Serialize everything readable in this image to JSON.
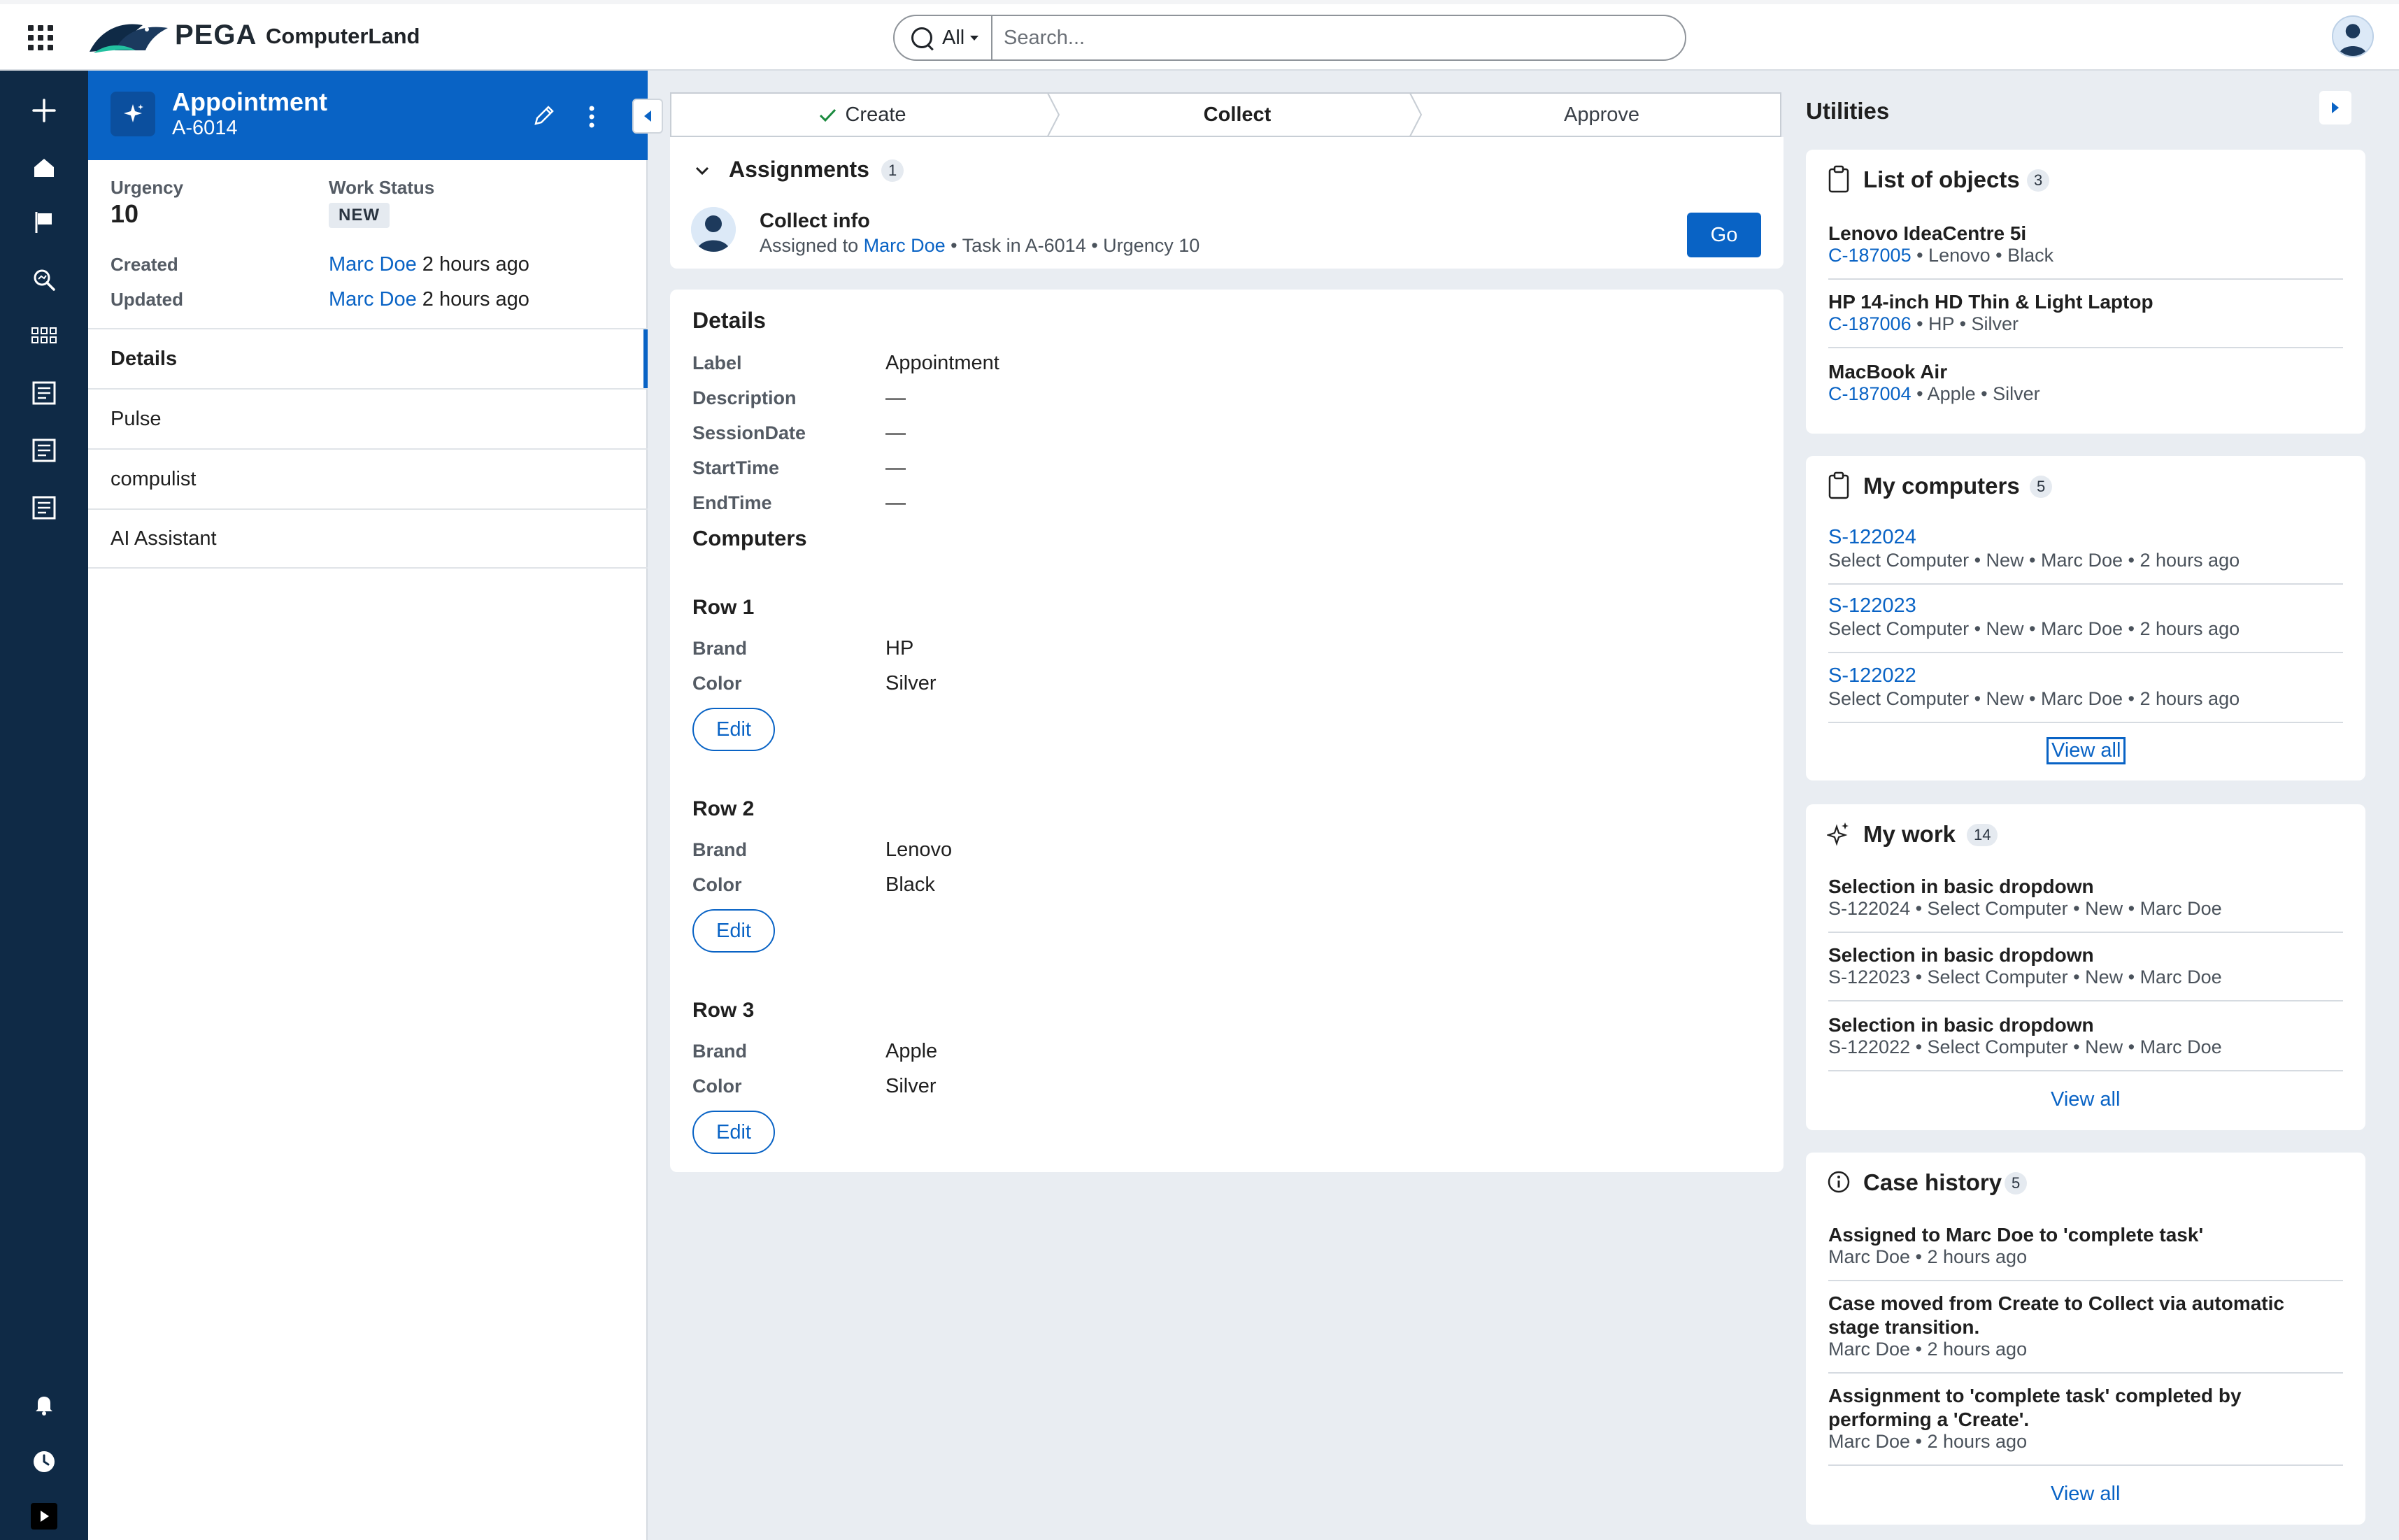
{
  "header": {
    "brand": "PEGA",
    "app_name": "ComputerLand",
    "search_scope": "All",
    "search_placeholder": "Search..."
  },
  "case": {
    "title": "Appointment",
    "id": "A-6014",
    "urgency_label": "Urgency",
    "urgency_value": "10",
    "work_status_label": "Work Status",
    "work_status_value": "NEW",
    "created_label": "Created",
    "created_by": "Marc Doe",
    "created_time": "2 hours ago",
    "updated_label": "Updated",
    "updated_by": "Marc Doe",
    "updated_time": "2 hours ago",
    "tabs": [
      {
        "label": "Details"
      },
      {
        "label": "Pulse"
      },
      {
        "label": "compulist"
      },
      {
        "label": "AI Assistant"
      }
    ]
  },
  "stages": [
    {
      "label": "Create"
    },
    {
      "label": "Collect"
    },
    {
      "label": "Approve"
    }
  ],
  "assignments": {
    "title": "Assignments",
    "count": "1",
    "item_title": "Collect info",
    "assigned_prefix": "Assigned to",
    "assignee": "Marc Doe",
    "meta_rest": " • Task in A-6014 • Urgency 10",
    "go_label": "Go"
  },
  "details": {
    "title": "Details",
    "fields": [
      {
        "label": "Label",
        "value": "Appointment"
      },
      {
        "label": "Description",
        "value": "—"
      },
      {
        "label": "SessionDate",
        "value": "—"
      },
      {
        "label": "StartTime",
        "value": "—"
      },
      {
        "label": "EndTime",
        "value": "—"
      }
    ],
    "computers_title": "Computers",
    "rows": [
      {
        "title": "Row 1",
        "brand_label": "Brand",
        "brand": "HP",
        "color_label": "Color",
        "color": "Silver",
        "edit": "Edit"
      },
      {
        "title": "Row 2",
        "brand_label": "Brand",
        "brand": "Lenovo",
        "color_label": "Color",
        "color": "Black",
        "edit": "Edit"
      },
      {
        "title": "Row 3",
        "brand_label": "Brand",
        "brand": "Apple",
        "color_label": "Color",
        "color": "Silver",
        "edit": "Edit"
      }
    ]
  },
  "utilities": {
    "title": "Utilities",
    "list_of_objects": {
      "title": "List of objects",
      "count": "3",
      "items": [
        {
          "title": "Lenovo IdeaCentre 5i",
          "id": "C-187005",
          "meta": " • Lenovo • Black"
        },
        {
          "title": "HP 14-inch HD Thin & Light Laptop",
          "id": "C-187006",
          "meta": " • HP • Silver"
        },
        {
          "title": "MacBook Air",
          "id": "C-187004",
          "meta": " • Apple • Silver"
        }
      ]
    },
    "my_computers": {
      "title": "My computers",
      "count": "5",
      "items": [
        {
          "id": "S-122024",
          "meta": "Select Computer • New • Marc Doe • 2 hours ago"
        },
        {
          "id": "S-122023",
          "meta": "Select Computer • New • Marc Doe • 2 hours ago"
        },
        {
          "id": "S-122022",
          "meta": "Select Computer • New • Marc Doe • 2 hours ago"
        }
      ],
      "view_all": "View all"
    },
    "my_work": {
      "title": "My work",
      "count": "14",
      "items": [
        {
          "title": "Selection in basic dropdown",
          "meta": "S-122024 • Select Computer • New • Marc Doe"
        },
        {
          "title": "Selection in basic dropdown",
          "meta": "S-122023 • Select Computer • New • Marc Doe"
        },
        {
          "title": "Selection in basic dropdown",
          "meta": "S-122022 • Select Computer • New • Marc Doe"
        }
      ],
      "view_all": "View all"
    },
    "case_history": {
      "title": "Case history",
      "count": "5",
      "items": [
        {
          "title_line1": "Assigned to Marc Doe to 'complete task'",
          "title_line2": "",
          "meta": "Marc Doe • 2 hours ago"
        },
        {
          "title_line1": "Case moved from Create to Collect via automatic",
          "title_line2": "stage transition.",
          "meta": "Marc Doe • 2 hours ago"
        },
        {
          "title_line1": "Assignment to 'complete task' completed by",
          "title_line2": "performing a 'Create'.",
          "meta": "Marc Doe • 2 hours ago"
        }
      ],
      "view_all": "View all"
    }
  },
  "nav_icons": [
    "plus-icon",
    "home-icon",
    "flag-icon",
    "explore-icon",
    "grid-icon",
    "report-icon",
    "report-icon",
    "report-icon",
    "bell-icon",
    "clock-icon",
    "play-icon"
  ],
  "colors": {
    "accent": "#0963c5",
    "nav_bg": "#0f2a46",
    "page_bg": "#e9edf2"
  }
}
